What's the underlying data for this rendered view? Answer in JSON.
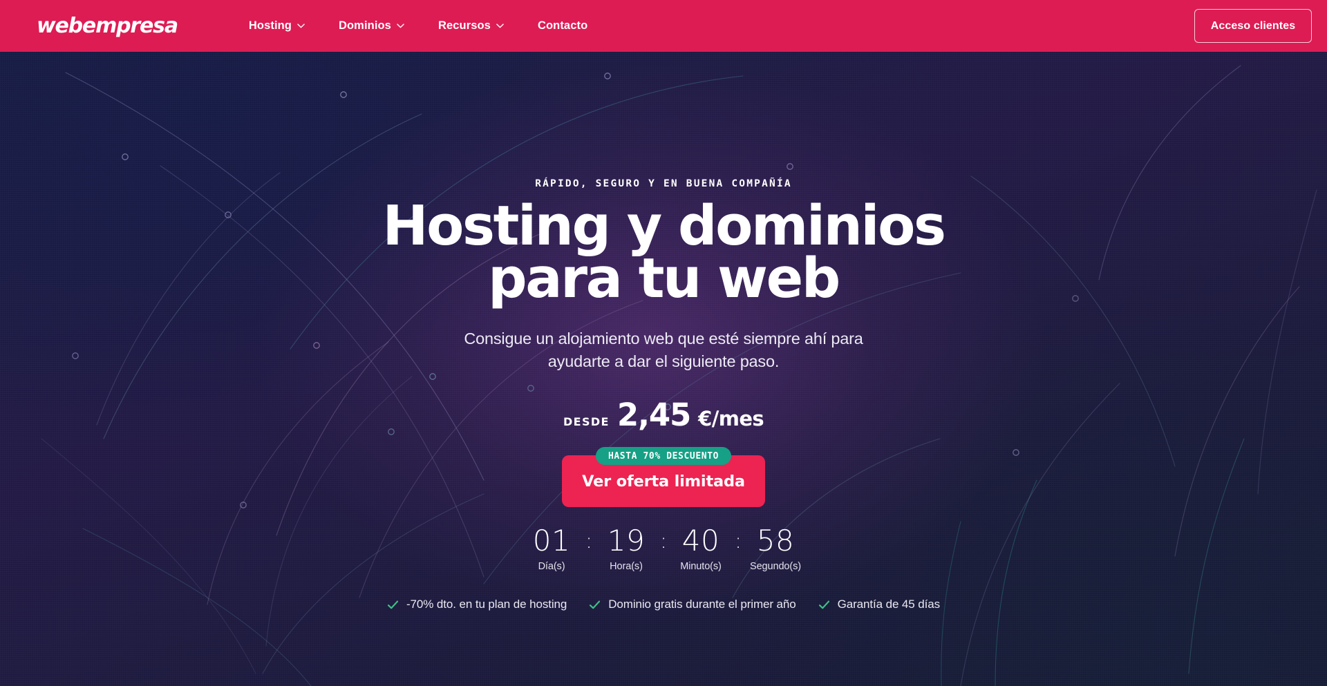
{
  "brand": {
    "logo_text": "webempresa",
    "accent_pink": "#dd1c54",
    "cta_pink": "#ed2352",
    "badge_teal": "#16a085",
    "check_green": "#3dbf85",
    "bg_navy": "#171c43"
  },
  "header": {
    "nav": [
      {
        "label": "Hosting",
        "icon": "chevron-down-icon",
        "has_dropdown": true
      },
      {
        "label": "Dominios",
        "icon": "chevron-down-icon",
        "has_dropdown": true
      },
      {
        "label": "Recursos",
        "icon": "chevron-down-icon",
        "has_dropdown": true
      },
      {
        "label": "Contacto",
        "icon": "",
        "has_dropdown": false
      }
    ],
    "access_button": "Acceso clientes"
  },
  "hero": {
    "eyebrow": "RÁPIDO, SEGURO Y EN BUENA COMPAÑÍA",
    "headline_line1": "Hosting y dominios",
    "headline_line2": "para tu web",
    "subhead_line1": "Consigue un alojamiento web que esté siempre ahí para",
    "subhead_line2": "ayudarte a dar el siguiente paso.",
    "price": {
      "prefix": "DESDE",
      "amount": "2,45",
      "unit": "€/mes"
    },
    "badge": "HASTA 70% DESCUENTO",
    "cta": "Ver oferta limitada",
    "countdown": {
      "separator": ":",
      "units": [
        {
          "value": "01",
          "label": "Día(s)"
        },
        {
          "value": "19",
          "label": "Hora(s)"
        },
        {
          "value": "40",
          "label": "Minuto(s)"
        },
        {
          "value": "58",
          "label": "Segundo(s)"
        }
      ]
    },
    "features": [
      {
        "icon": "check-icon",
        "label": "-70% dto. en tu plan de hosting"
      },
      {
        "icon": "check-icon",
        "label": "Dominio gratis durante el primer año"
      },
      {
        "icon": "check-icon",
        "label": "Garantía de 45 días"
      }
    ]
  }
}
